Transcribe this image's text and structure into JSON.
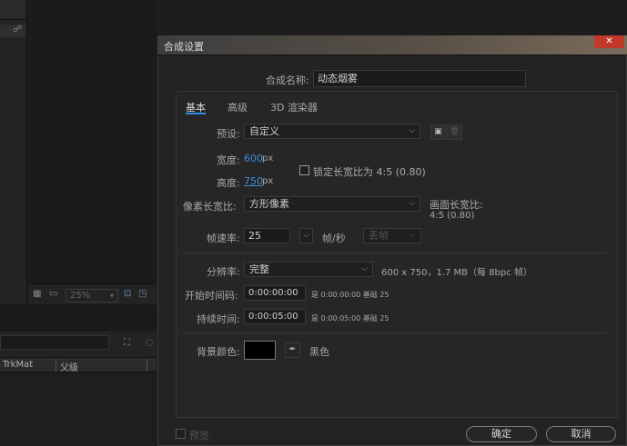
{
  "dialog": {
    "title": "合成设置",
    "close_glyph": "✕",
    "comp_name_label": "合成名称:",
    "comp_name_value": "动态烟雾",
    "tabs": [
      {
        "label": "基本",
        "active": true
      },
      {
        "label": "高级",
        "active": false
      },
      {
        "label": "3D 渲染器",
        "active": false
      }
    ],
    "preset": {
      "label": "预设:",
      "value": "自定义",
      "save_icon": "save-preset-icon",
      "delete_icon": "trash-icon"
    },
    "width": {
      "label": "宽度:",
      "value": "600",
      "unit": "px"
    },
    "height": {
      "label": "高度:",
      "value": "750",
      "unit": "px"
    },
    "lock_aspect": {
      "label": "锁定长宽比为 4:5 (0.80)",
      "checked": false
    },
    "pixel_aspect": {
      "label": "像素长宽比:",
      "value": "方形像素"
    },
    "frame_aspect": {
      "label": "画面长宽比:",
      "value": "4:5 (0.80)"
    },
    "frame_rate": {
      "label": "帧速率:",
      "value": "25",
      "unit": "帧/秒",
      "drop_frame": "丢帧"
    },
    "resolution": {
      "label": "分辨率:",
      "value": "完整",
      "info": "600 x 750，1.7 MB（每 8bpc 帧）"
    },
    "start_timecode": {
      "label": "开始时间码:",
      "value": "0:00:00:00",
      "note": "是 0:00:00:00  基础 25"
    },
    "duration": {
      "label": "持续时间:",
      "value": "0:00:05:00",
      "note": "是 0:00:05:00  基础 25"
    },
    "background": {
      "label": "背景颜色:",
      "color": "#000000",
      "name": "黑色",
      "eyedropper_icon": "eyedropper-icon"
    },
    "preview": {
      "label": "预览",
      "checked": false
    },
    "ok_label": "确定",
    "cancel_label": "取消"
  },
  "background_app": {
    "zoom_value": "25%",
    "timeline_columns": [
      "TrkMat",
      "父级"
    ]
  },
  "colors": {
    "accent": "#2d8ceb",
    "close": "#c0392b",
    "link_value": "#3f8fd6"
  }
}
